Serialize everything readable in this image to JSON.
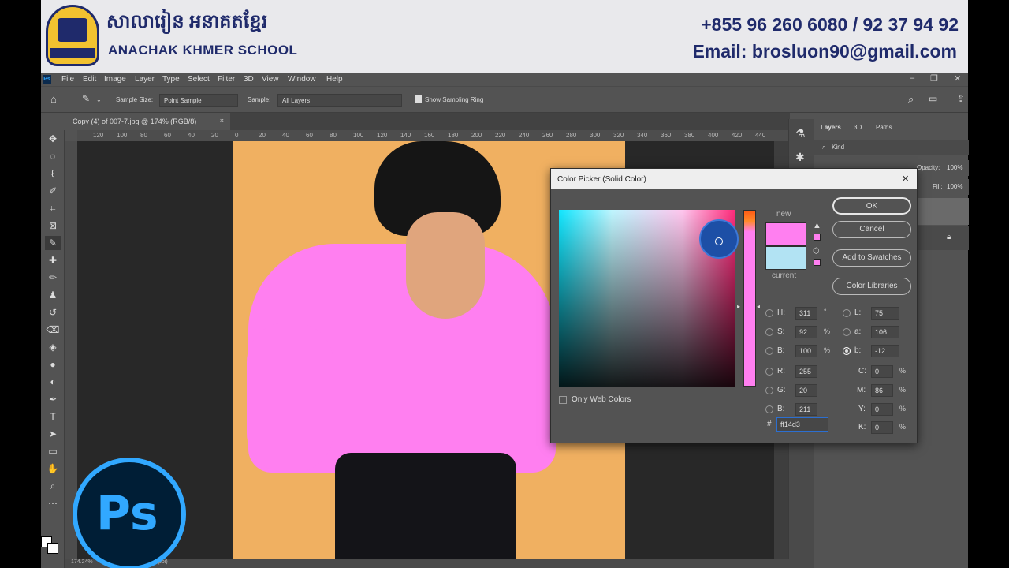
{
  "banner": {
    "school_kh": "សាលារៀន អនាគតខ្មែរ",
    "school_en": "ANACHAK KHMER SCHOOL",
    "phone": "+855 96 260 6080 / 92 37 94 92",
    "email": "Email: brosluon90@gmail.com"
  },
  "menubar": {
    "items": [
      "File",
      "Edit",
      "Image",
      "Layer",
      "Type",
      "Select",
      "Filter",
      "3D",
      "View",
      "Window",
      "Help"
    ]
  },
  "options": {
    "sample_size_label": "Sample Size:",
    "sample_size_value": "Point Sample",
    "sample_label": "Sample:",
    "sample_value": "All Layers",
    "show_ring_label": "Show Sampling Ring"
  },
  "document": {
    "tab_title": "Copy (4) of 007-7.jpg @ 174% (RGB/8)",
    "ruler_ticks": [
      "120",
      "100",
      "80",
      "60",
      "40",
      "20",
      "0",
      "20",
      "40",
      "60",
      "80",
      "100",
      "120",
      "140",
      "160",
      "180",
      "200",
      "220",
      "240",
      "260",
      "280",
      "300",
      "320",
      "340",
      "360",
      "380",
      "400",
      "420",
      "440"
    ],
    "zoom_status": "174.24%",
    "size_status": "px (85 ppi)"
  },
  "layers_panel": {
    "tabs": [
      "Layers",
      "3D",
      "Paths"
    ],
    "kind_label": "Kind",
    "opacity_label": "Opacity:",
    "opacity_value": "100%",
    "fill_label": "Fill:",
    "fill_value": "100%"
  },
  "color_picker": {
    "title": "Color Picker (Solid Color)",
    "new_label": "new",
    "current_label": "current",
    "buttons": {
      "ok": "OK",
      "cancel": "Cancel",
      "add_swatches": "Add to Swatches",
      "libraries": "Color Libraries"
    },
    "only_web_colors": "Only Web Colors",
    "hsb": {
      "H": "311",
      "S": "92",
      "B": "100"
    },
    "rgb": {
      "R": "255",
      "G": "20",
      "B": "211"
    },
    "lab": {
      "L": "75",
      "a": "106",
      "b": "-12"
    },
    "cmyk": {
      "C": "0",
      "M": "86",
      "Y": "0",
      "K": "0"
    },
    "hex": "ff14d3",
    "new_color": "#ff7ff0",
    "current_color": "#b2e3f3"
  },
  "ps_logo": "Ps"
}
